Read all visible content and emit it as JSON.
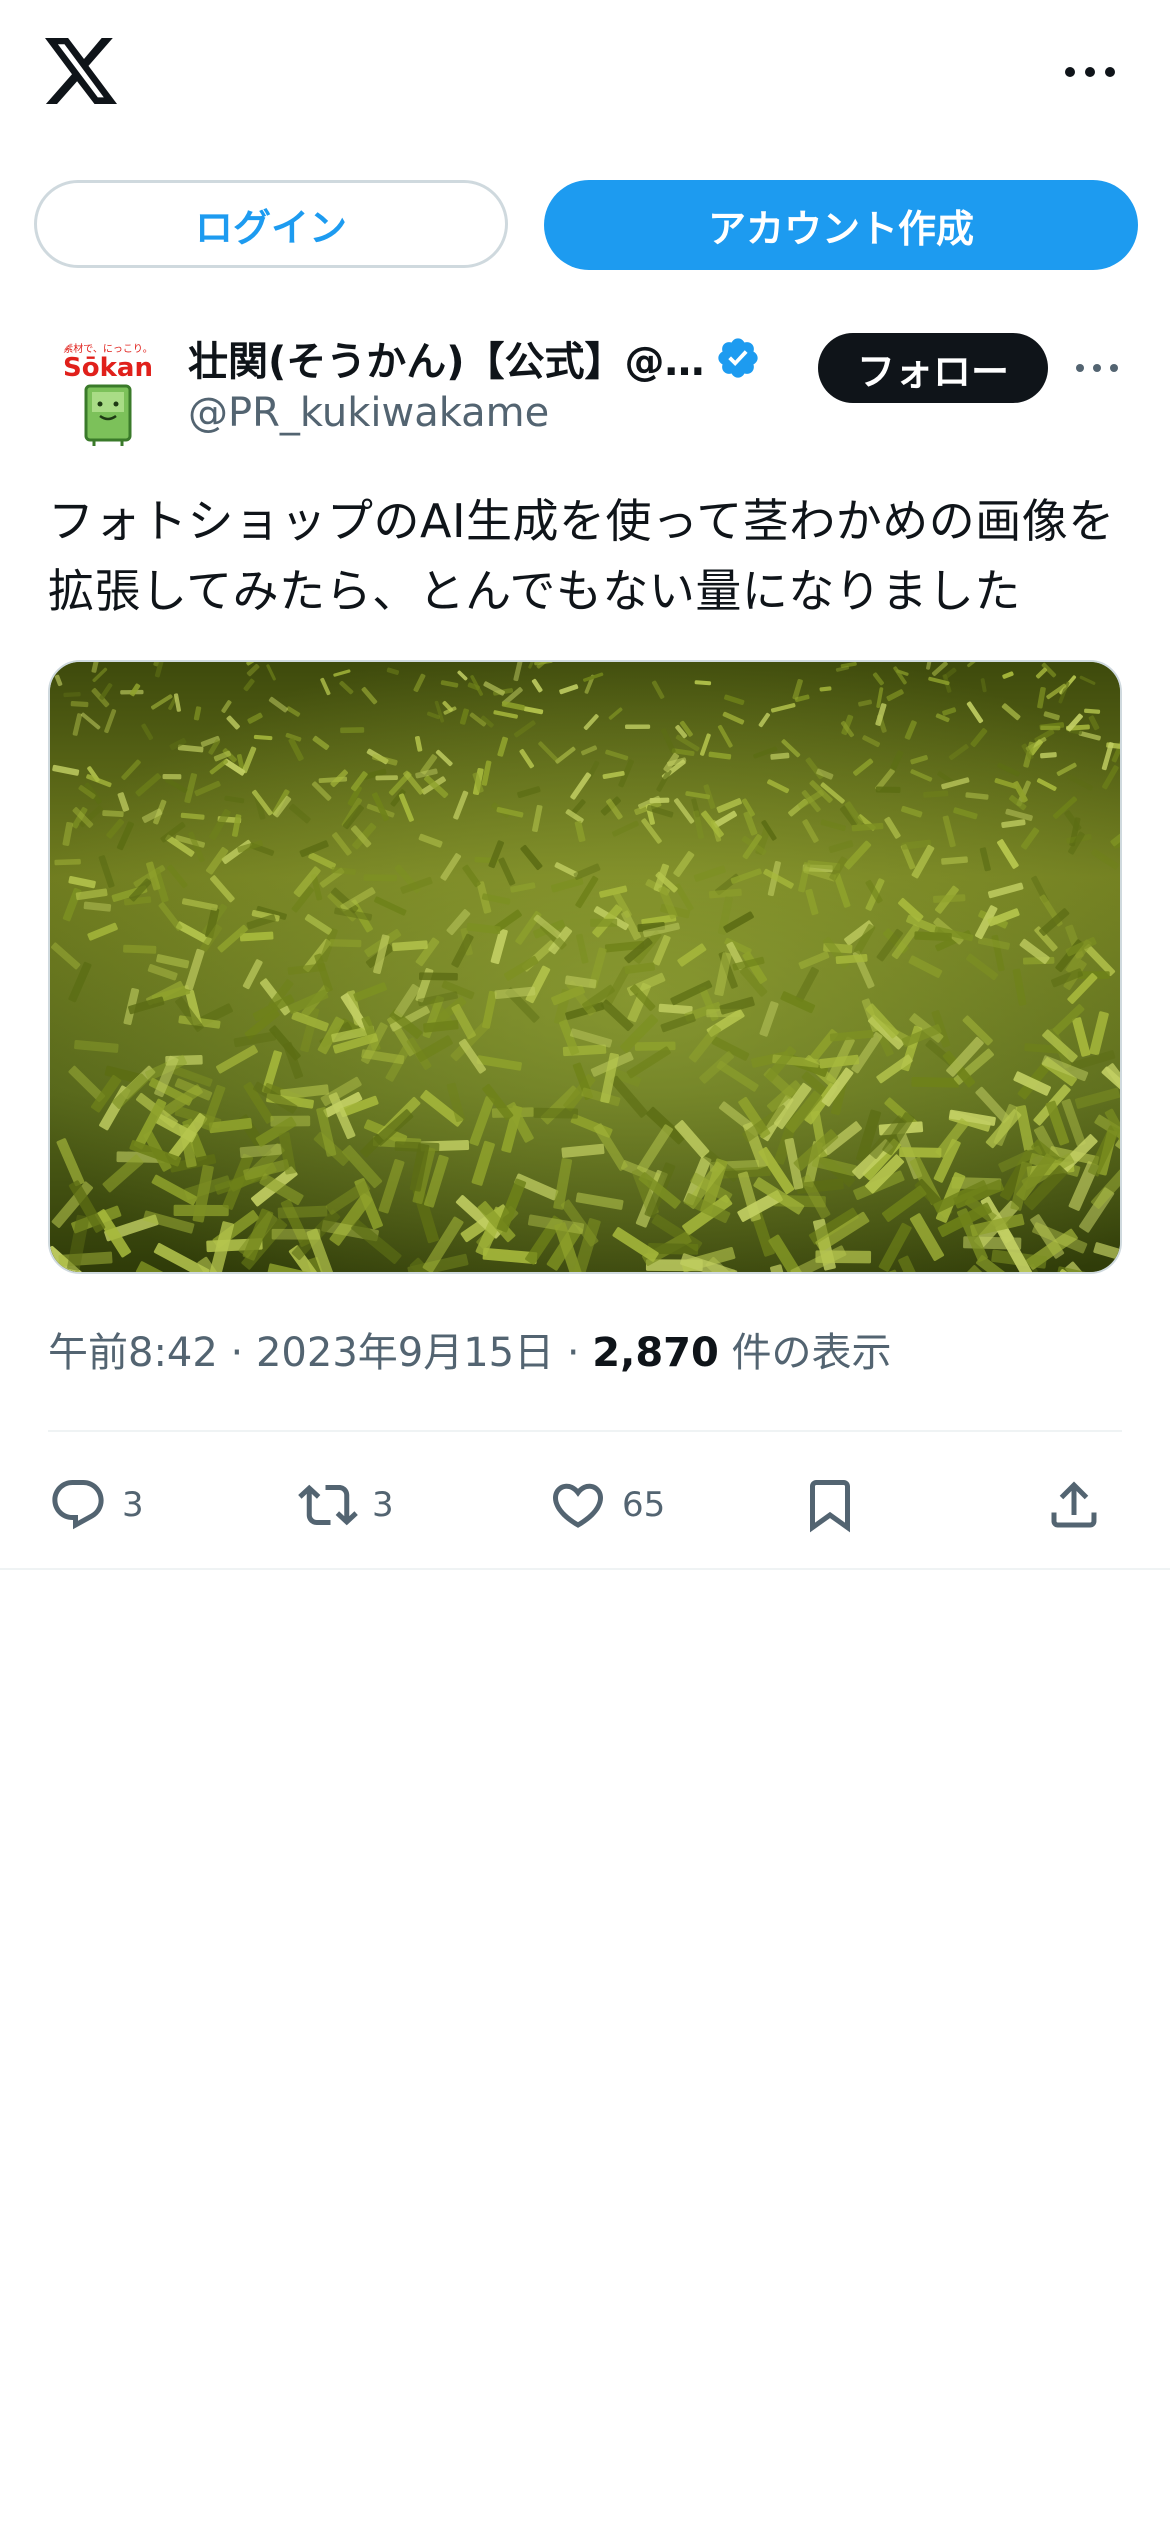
{
  "auth": {
    "login_label": "ログイン",
    "signup_label": "アカウント作成"
  },
  "tweet": {
    "display_name": "壮関(そうかん)【公式】@…",
    "handle": "@PR_kukiwakame",
    "follow_label": "フォロー",
    "text": "フォトショップのAI生成を使って茎わかめの画像を拡張してみたら、とんでもない量になりました",
    "time": "午前8:42",
    "date": "2023年9月15日",
    "separator": "·",
    "views_count": "2,870",
    "views_label": "件の表示",
    "avatar_logo": {
      "tagline": "素材で、にっこり。",
      "brand": "Sōkan"
    }
  },
  "actions": {
    "replies": "3",
    "retweets": "3",
    "likes": "65"
  },
  "colors": {
    "accent": "#1d9bf0",
    "text_primary": "#0f1419",
    "text_secondary": "#536471",
    "border": "#cfd9de",
    "brand_red": "#e0201b",
    "brand_green": "#5aa846"
  },
  "icons": {
    "logo": "x-logo-icon",
    "more": "more-horizontal-icon",
    "verified": "verified-badge-icon",
    "reply": "reply-icon",
    "retweet": "retweet-icon",
    "like": "heart-icon",
    "bookmark": "bookmark-icon",
    "share": "share-icon"
  }
}
